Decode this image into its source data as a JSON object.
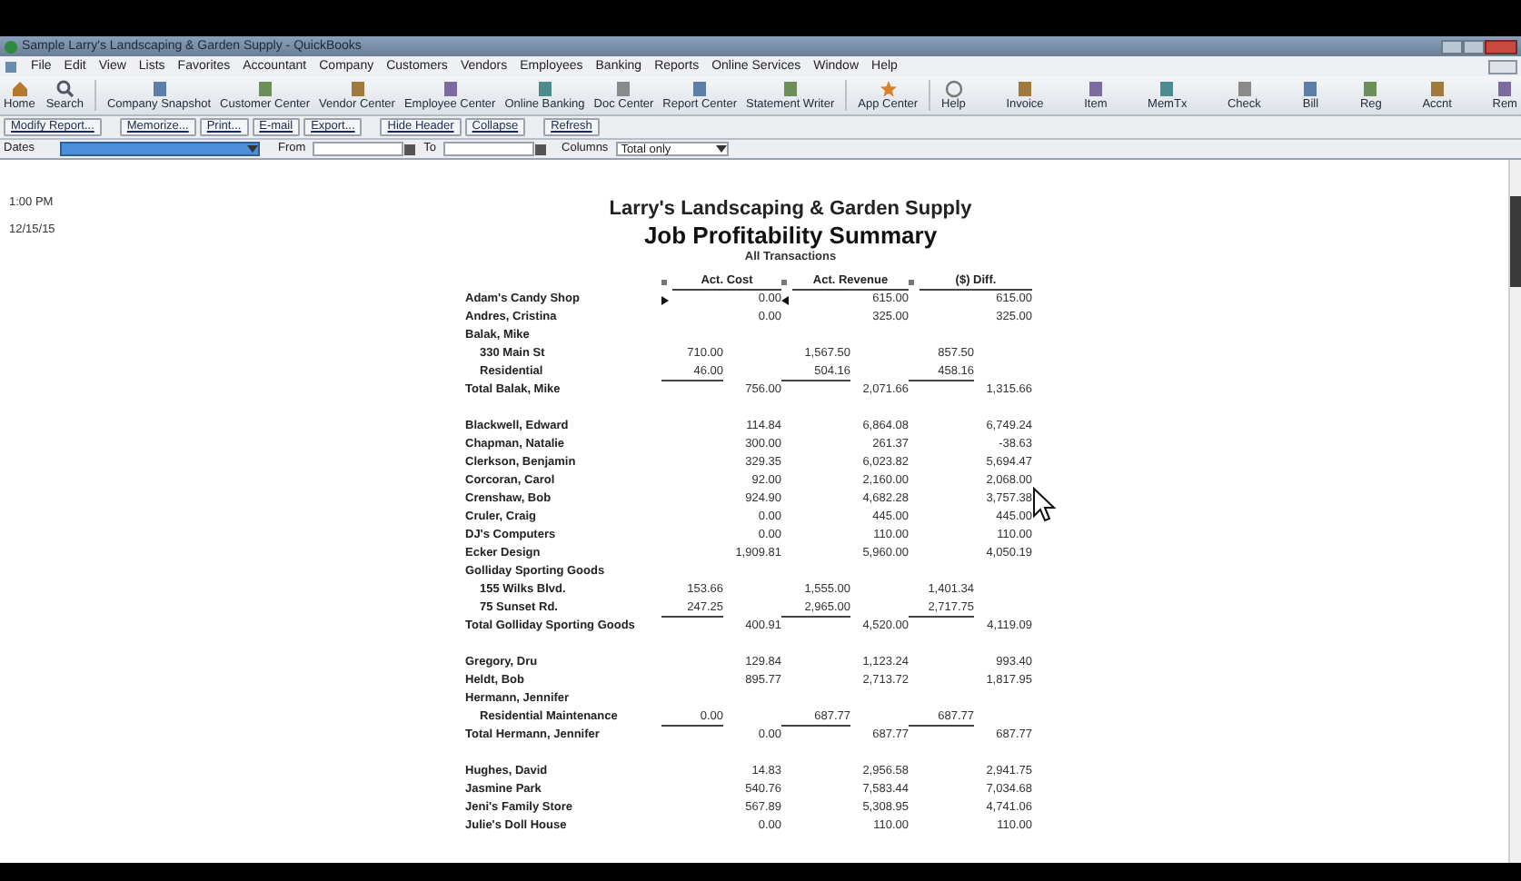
{
  "window": {
    "title": "Sample Larry's Landscaping & Garden Supply - QuickBooks"
  },
  "menu": [
    "File",
    "Edit",
    "View",
    "Lists",
    "Favorites",
    "Accountant",
    "Company",
    "Customers",
    "Vendors",
    "Employees",
    "Banking",
    "Reports",
    "Online Services",
    "Window",
    "Help"
  ],
  "toolbar_groups": [
    {
      "items": [
        "Home",
        "Search"
      ]
    },
    {
      "items": [
        "Company Snapshot",
        "Customer Center",
        "Vendor Center",
        "Employee Center",
        "Online Banking",
        "Doc Center",
        "Report Center",
        "Statement Writer"
      ]
    },
    {
      "items": [
        "App Center"
      ]
    },
    {
      "items": [
        "Help",
        "Invoice",
        "Item",
        "MemTx",
        "Check",
        "Bill",
        "Reg",
        "Accnt",
        "Rem"
      ]
    }
  ],
  "report_buttons": [
    [
      "Modify Report..."
    ],
    [
      "Memorize...",
      "Print...",
      "E-mail",
      "Export..."
    ],
    [
      "Hide Header",
      "Collapse"
    ],
    [
      "Refresh"
    ]
  ],
  "filters": {
    "dates_label": "Dates",
    "from_label": "From",
    "to_label": "To",
    "columns_label": "Columns",
    "columns_value": "Total only"
  },
  "report": {
    "time": "1:00 PM",
    "date": "12/15/15",
    "company": "Larry's Landscaping & Garden Supply",
    "title": "Job Profitability Summary",
    "basis": "All Transactions",
    "columns": [
      "Act. Cost",
      "Act. Revenue",
      "($) Diff."
    ],
    "rows": [
      {
        "kind": "job",
        "name": "Adam's Candy Shop",
        "values": [
          "0.00",
          "615.00",
          "615.00"
        ],
        "selected": true
      },
      {
        "kind": "job",
        "name": "Andres, Cristina",
        "values": [
          "0.00",
          "325.00",
          "325.00"
        ],
        "selected": false
      },
      {
        "kind": "header",
        "name": "Balak, Mike"
      },
      {
        "kind": "sub",
        "name": "330 Main St",
        "values": [
          "710.00",
          "1,567.50",
          "857.50"
        ],
        "underlined": false
      },
      {
        "kind": "sub",
        "name": "Residential",
        "values": [
          "46.00",
          "504.16",
          "458.16"
        ],
        "underlined": true
      },
      {
        "kind": "total",
        "name": "Total Balak, Mike",
        "values": [
          "756.00",
          "2,071.66",
          "1,315.66"
        ]
      },
      {
        "kind": "blank"
      },
      {
        "kind": "job",
        "name": "Blackwell, Edward",
        "values": [
          "114.84",
          "6,864.08",
          "6,749.24"
        ],
        "selected": false
      },
      {
        "kind": "job",
        "name": "Chapman, Natalie",
        "values": [
          "300.00",
          "261.37",
          "-38.63"
        ],
        "selected": false
      },
      {
        "kind": "job",
        "name": "Clerkson, Benjamin",
        "values": [
          "329.35",
          "6,023.82",
          "5,694.47"
        ],
        "selected": false
      },
      {
        "kind": "job",
        "name": "Corcoran, Carol",
        "values": [
          "92.00",
          "2,160.00",
          "2,068.00"
        ],
        "selected": false
      },
      {
        "kind": "job",
        "name": "Crenshaw, Bob",
        "values": [
          "924.90",
          "4,682.28",
          "3,757.38"
        ],
        "selected": false
      },
      {
        "kind": "job",
        "name": "Cruler, Craig",
        "values": [
          "0.00",
          "445.00",
          "445.00"
        ],
        "selected": false
      },
      {
        "kind": "job",
        "name": "DJ's Computers",
        "values": [
          "0.00",
          "110.00",
          "110.00"
        ],
        "selected": false
      },
      {
        "kind": "job",
        "name": "Ecker Design",
        "values": [
          "1,909.81",
          "5,960.00",
          "4,050.19"
        ],
        "selected": false
      },
      {
        "kind": "header",
        "name": "Golliday Sporting Goods"
      },
      {
        "kind": "sub",
        "name": "155 Wilks Blvd.",
        "values": [
          "153.66",
          "1,555.00",
          "1,401.34"
        ],
        "underlined": false
      },
      {
        "kind": "sub",
        "name": "75 Sunset Rd.",
        "values": [
          "247.25",
          "2,965.00",
          "2,717.75"
        ],
        "underlined": true
      },
      {
        "kind": "total",
        "name": "Total Golliday Sporting Goods",
        "values": [
          "400.91",
          "4,520.00",
          "4,119.09"
        ]
      },
      {
        "kind": "blank"
      },
      {
        "kind": "job",
        "name": "Gregory, Dru",
        "values": [
          "129.84",
          "1,123.24",
          "993.40"
        ],
        "selected": false
      },
      {
        "kind": "job",
        "name": "Heldt, Bob",
        "values": [
          "895.77",
          "2,713.72",
          "1,817.95"
        ],
        "selected": false
      },
      {
        "kind": "header",
        "name": "Hermann, Jennifer"
      },
      {
        "kind": "sub",
        "name": "Residential Maintenance",
        "values": [
          "0.00",
          "687.77",
          "687.77"
        ],
        "underlined": true
      },
      {
        "kind": "total",
        "name": "Total Hermann, Jennifer",
        "values": [
          "0.00",
          "687.77",
          "687.77"
        ]
      },
      {
        "kind": "blank"
      },
      {
        "kind": "job",
        "name": "Hughes, David",
        "values": [
          "14.83",
          "2,956.58",
          "2,941.75"
        ],
        "selected": false
      },
      {
        "kind": "job",
        "name": "Jasmine Park",
        "values": [
          "540.76",
          "7,583.44",
          "7,034.68"
        ],
        "selected": false
      },
      {
        "kind": "job",
        "name": "Jeni's Family Store",
        "values": [
          "567.89",
          "5,308.95",
          "4,741.06"
        ],
        "selected": false
      },
      {
        "kind": "job",
        "name": "Julie's Doll House",
        "values": [
          "0.00",
          "110.00",
          "110.00"
        ],
        "selected": false
      }
    ]
  }
}
